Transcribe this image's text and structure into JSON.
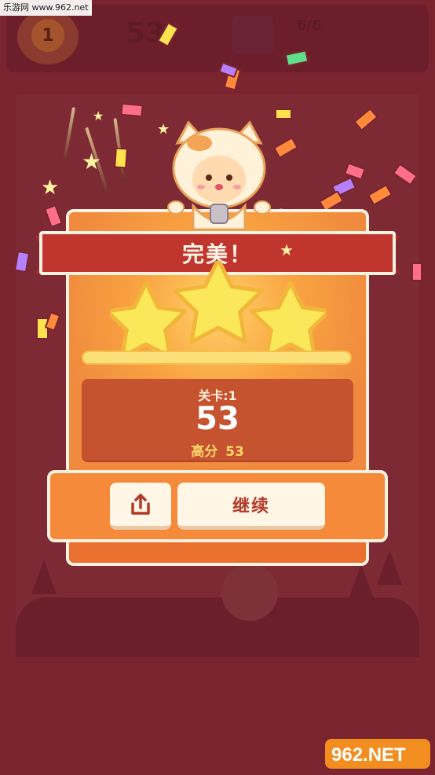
{
  "watermark": {
    "top_text": "乐游网 www.962.net",
    "logo_text": "962.NET",
    "logo_sub": "乐游网"
  },
  "background_hud": {
    "level_value": "1",
    "score_value": "53",
    "moves_value": "6/6"
  },
  "result": {
    "title": "完美！",
    "stars_earned": 3,
    "stars_total": 3,
    "progress_fraction": 1.0,
    "level_text": "关卡:1",
    "score": "53",
    "best_label": "高分",
    "best_value": "53"
  },
  "buttons": {
    "share_icon": "share-icon",
    "continue_label": "继续"
  },
  "colors": {
    "backdrop": "#7a2430",
    "card": "#ef8a3e",
    "ribbon": "#c0362e",
    "star": "#fbe85a",
    "best_score": "#ffd76a"
  }
}
